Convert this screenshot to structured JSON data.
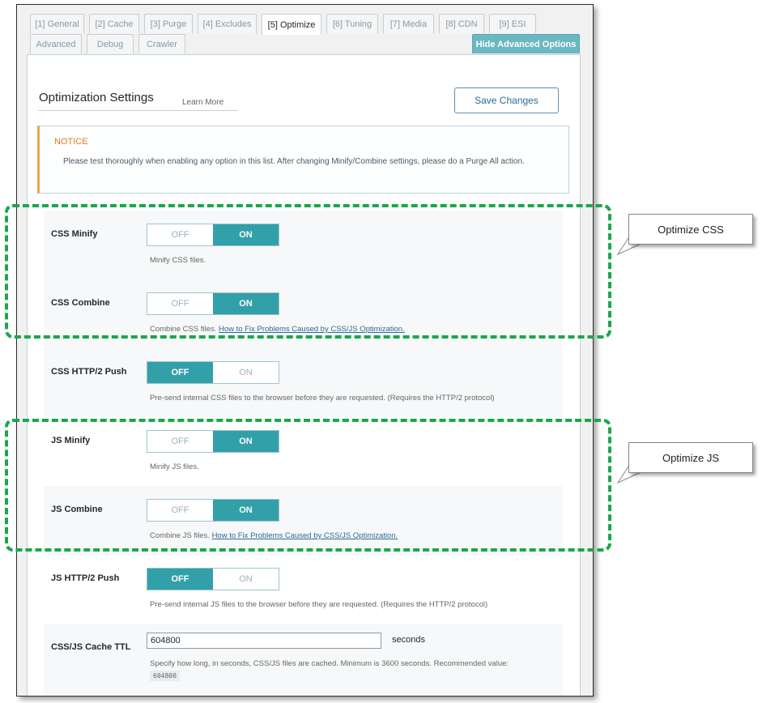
{
  "tabs_row1": [
    "[1] General",
    "[2] Cache",
    "[3] Purge",
    "[4] Excludes",
    "[5] Optimize",
    "[6] Tuning",
    "[7] Media",
    "[8] CDN",
    "[9] ESI"
  ],
  "tabs_row2": [
    "Advanced",
    "Debug",
    "Crawler"
  ],
  "hide_advanced": "Hide Advanced Options",
  "page_title": "Optimization Settings",
  "learn_more": "Learn More",
  "save_button": "Save Changes",
  "notice": {
    "title": "NOTICE",
    "text": "Please test thoroughly when enabling any option in this list. After changing Minify/Combine settings, please do a Purge All action."
  },
  "toggle_labels": {
    "off": "OFF",
    "on": "ON"
  },
  "settings": [
    {
      "label": "CSS Minify",
      "state": "on",
      "desc": "Minify CSS files.",
      "link": ""
    },
    {
      "label": "CSS Combine",
      "state": "on",
      "desc": "Combine CSS files.",
      "link": "How to Fix Problems Caused by CSS/JS Optimization."
    },
    {
      "label": "CSS HTTP/2 Push",
      "state": "off",
      "desc": "Pre-send internal CSS files to the browser before they are requested. (Requires the HTTP/2 protocol)",
      "link": ""
    },
    {
      "label": "JS Minify",
      "state": "on",
      "desc": "Minify JS files.",
      "link": ""
    },
    {
      "label": "JS Combine",
      "state": "on",
      "desc": "Combine JS files.",
      "link": "How to Fix Problems Caused by CSS/JS Optimization."
    },
    {
      "label": "JS HTTP/2 Push",
      "state": "off",
      "desc": "Pre-send internal JS files to the browser before they are requested. (Requires the HTTP/2 protocol)",
      "link": ""
    }
  ],
  "ttl": {
    "label": "CSS/JS Cache TTL",
    "value": "604800",
    "unit": "seconds",
    "desc": "Specify how long, in seconds, CSS/JS files are cached. Minimum is 3600 seconds. Recommended value:",
    "recommended": "604800"
  },
  "callouts": {
    "css": "Optimize CSS",
    "js": "Optimize JS"
  },
  "colors": {
    "accent": "#32a0a8",
    "highlight": "#19a84a",
    "notice": "#f0a44a"
  }
}
